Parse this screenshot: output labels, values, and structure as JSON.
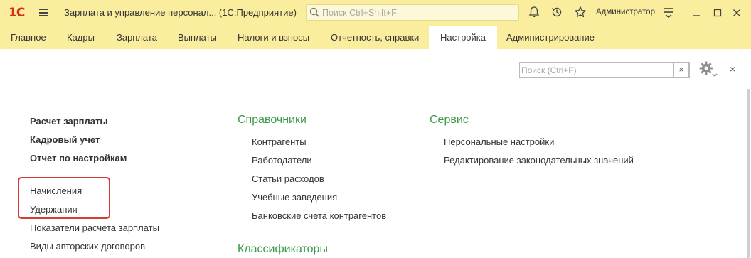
{
  "titlebar": {
    "logo": "1С",
    "app_title": "Зарплата и управление персонал...  (1С:Предприятие)",
    "search_placeholder": "Поиск Ctrl+Shift+F",
    "user": "Администратор"
  },
  "tabs": [
    {
      "label": "Главное"
    },
    {
      "label": "Кадры"
    },
    {
      "label": "Зарплата"
    },
    {
      "label": "Выплаты"
    },
    {
      "label": "Налоги и взносы"
    },
    {
      "label": "Отчетность, справки"
    },
    {
      "label": "Настройка",
      "active": true
    },
    {
      "label": "Администрирование"
    }
  ],
  "content": {
    "search_placeholder": "Поиск (Ctrl+F)",
    "clear_label": "×",
    "close_label": "×",
    "left_bold": [
      "Расчет зарплаты",
      "Кадровый учет",
      "Отчет по настройкам"
    ],
    "left_items": [
      "Начисления",
      "Удержания",
      "Показатели расчета зарплаты",
      "Виды авторских договоров"
    ],
    "groups": [
      {
        "title": "Справочники",
        "items": [
          "Контрагенты",
          "Работодатели",
          "Статьи расходов",
          "Учебные заведения",
          "Банковские счета контрагентов"
        ]
      },
      {
        "title": "Сервис",
        "items": [
          "Персональные настройки",
          "Редактирование законодательных значений"
        ]
      },
      {
        "title": "Классификаторы",
        "items": []
      }
    ]
  },
  "colors": {
    "titlebar_bg": "#fbed9e",
    "group_title": "#3b9a4a",
    "highlight": "#d83b36",
    "logo": "#d42f1f"
  }
}
